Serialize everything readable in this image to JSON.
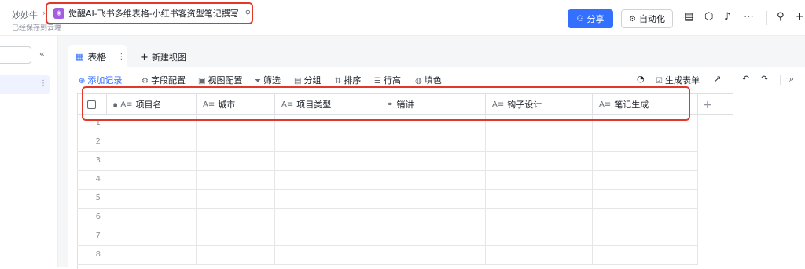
{
  "topbar": {
    "crumb": "妙妙牛",
    "crumb_sep": "›",
    "saved_status": "已经保存到云端",
    "doc_title": "觉醒AI-飞书多维表格-小红书客资型笔记撰写",
    "share_label": "分享",
    "automation_label": "自动化",
    "icons": [
      "share-icon",
      "automation-icon",
      "doc-icon",
      "plugin-icon",
      "bell-icon",
      "more-icon",
      "search-icon",
      "add-icon"
    ]
  },
  "sidebar": {
    "collapse_glyph": "«",
    "more_glyph": "⋮"
  },
  "tabs": {
    "active_label": "表格",
    "new_view_label": "新建视图"
  },
  "toolbar": {
    "add_record": "添加记录",
    "field_config": "字段配置",
    "view_config": "视图配置",
    "filter": "筛选",
    "group": "分组",
    "sort": "排序",
    "row_height": "行高",
    "fill_color": "填色",
    "generate_form": "生成表单"
  },
  "table": {
    "columns": [
      {
        "label": "项目名",
        "type": "text"
      },
      {
        "label": "城市",
        "type": "text"
      },
      {
        "label": "项目类型",
        "type": "text"
      },
      {
        "label": "销讲",
        "type": "link"
      },
      {
        "label": "钩子设计",
        "type": "text"
      },
      {
        "label": "笔记生成",
        "type": "text"
      }
    ],
    "row_numbers": [
      "1",
      "2",
      "3",
      "4",
      "5",
      "6",
      "7",
      "8"
    ]
  },
  "colors": {
    "accent": "#3370ff",
    "highlight": "#e0392b",
    "doc_icon": "#a45ee0"
  }
}
